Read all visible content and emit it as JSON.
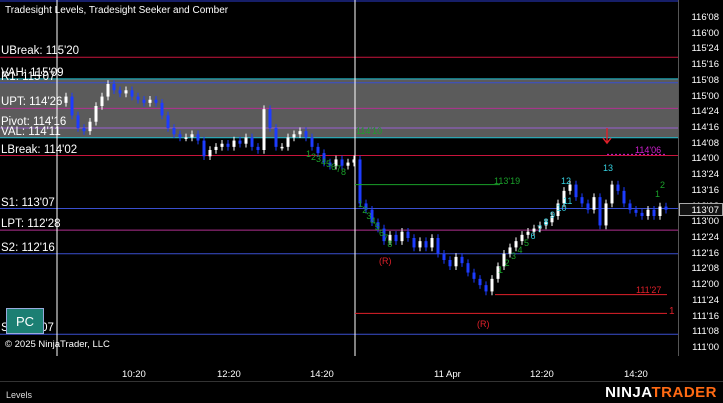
{
  "window": {
    "title": "Tradesight Levels, Tradesight Seeker and Comber",
    "copyright": "© 2025 NinjaTrader, LLC",
    "footer_tab": "Levels",
    "brand_left": "NINJA",
    "brand_right": "TRADER",
    "pc_button": "PC"
  },
  "levels": [
    {
      "label": "UBreak: 115'20",
      "price": 115.625,
      "color": "#c8143c"
    },
    {
      "label": "VAH: 115'09",
      "price": 115.281,
      "color": "#20c0d0"
    },
    {
      "label": "R1: 115'07",
      "price": 115.219,
      "color": "#3a4fd0"
    },
    {
      "label": "UPT: 114'26",
      "price": 114.8125,
      "color": "#b03090"
    },
    {
      "label": "Pivot: 114'16",
      "price": 114.5,
      "color": "#9a5fd0"
    },
    {
      "label": "VAL: 114'11",
      "price": 114.344,
      "color": "#20c0d0"
    },
    {
      "label": "LBreak: 114'02",
      "price": 114.0625,
      "color": "#c8143c"
    },
    {
      "label": "S1: 113'07",
      "price": 113.219,
      "color": "#3a4fd0"
    },
    {
      "label": "LPT: 112'28",
      "price": 112.875,
      "color": "#b03090"
    },
    {
      "label": "S2: 112'16",
      "price": 112.5,
      "color": "#3a4fd0"
    },
    {
      "label": "S3: 111'07",
      "price": 111.219,
      "color": "#3a4fd0"
    }
  ],
  "y_axis": {
    "ticks": [
      "116'08",
      "116'00",
      "115'24",
      "115'16",
      "115'08",
      "115'00",
      "114'24",
      "114'16",
      "114'08",
      "114'00",
      "113'24",
      "113'16",
      "113'08",
      "113'00",
      "112'24",
      "112'16",
      "112'08",
      "112'00",
      "111'24",
      "111'16",
      "111'08",
      "111'00"
    ],
    "top_price": 116.25,
    "bottom_price": 111.0,
    "current_price": "113'07"
  },
  "x_axis": {
    "ticks": [
      "10:20",
      "12:20",
      "14:20",
      "11 Apr",
      "12:20",
      "14:20"
    ]
  },
  "annotations": {
    "seeker_counts_up": [
      "12",
      "13",
      "2",
      "1"
    ],
    "seeker_counts_cyan": [
      "1",
      "2",
      "3",
      "4",
      "5",
      "6",
      "7",
      "8",
      "9",
      "10",
      "11"
    ],
    "comber_down": [
      "1",
      "2",
      "3",
      "4",
      "5",
      "6",
      "7",
      "8",
      "9",
      "10",
      "11",
      "12",
      "13"
    ],
    "price_tags": [
      "114'06",
      "113'19",
      "111'27",
      "114'10"
    ],
    "r_markers": [
      "(R)",
      "(R)"
    ],
    "count_red": "1"
  },
  "colors": {
    "bull": "#ffffff",
    "bear": "#1d3cff",
    "value_area": "#6b6b6b",
    "green": "#1aa02a",
    "cyan": "#35d0e0",
    "red": "#e0202a",
    "magenta": "#d020d0",
    "accent": "#ff6a13"
  }
}
